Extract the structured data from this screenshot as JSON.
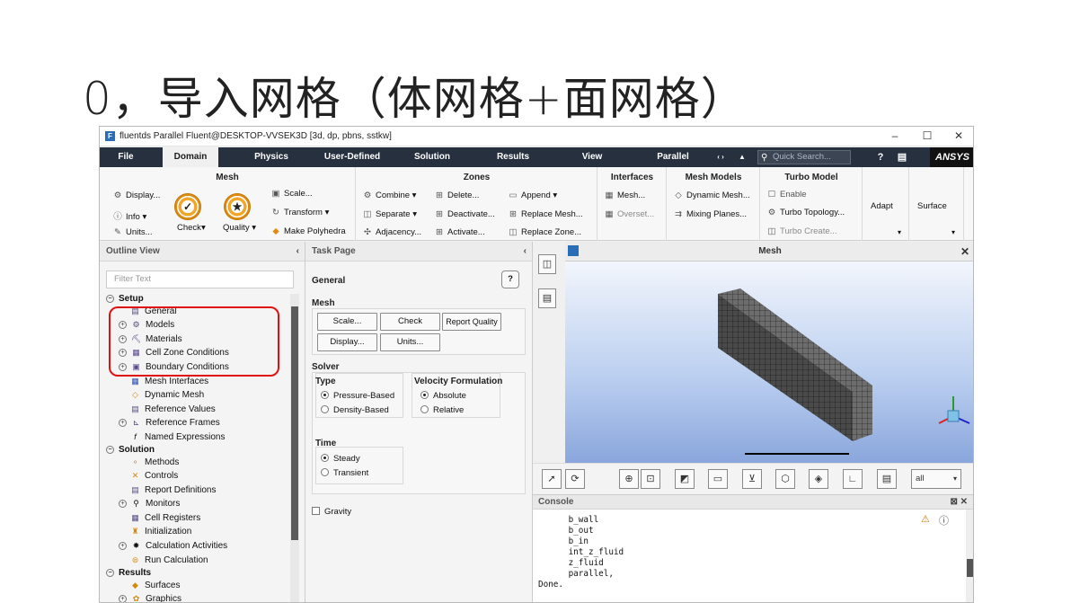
{
  "slide": {
    "title": "0，导入网格（体网格+面网格）"
  },
  "window": {
    "title": "fluentds Parallel Fluent@DESKTOP-VVSEK3D  [3d, dp, pbns, sstkw]",
    "controls": [
      "–",
      "☐",
      "✕"
    ]
  },
  "menubar": {
    "items": [
      "File",
      "Domain",
      "Physics",
      "User-Defined",
      "Solution",
      "Results",
      "View",
      "Parallel"
    ],
    "active": "Domain",
    "search_placeholder": "Quick Search...",
    "brand": "ANSYS"
  },
  "ribbon": {
    "mesh": {
      "header": "Mesh",
      "display": "Display...",
      "info": "Info",
      "units": "Units...",
      "check": "Check",
      "quality": "Quality",
      "scale": "Scale...",
      "transform": "Transform",
      "make_polyhedra": "Make Polyhedra"
    },
    "zones": {
      "header": "Zones",
      "combine": "Combine",
      "separate": "Separate",
      "adjacency": "Adjacency...",
      "delete": "Delete...",
      "deactivate": "Deactivate...",
      "activate": "Activate...",
      "append": "Append",
      "replace_mesh": "Replace Mesh...",
      "replace_zone": "Replace Zone..."
    },
    "interfaces": {
      "header": "Interfaces",
      "mesh": "Mesh...",
      "overset": "Overset..."
    },
    "mesh_models": {
      "header": "Mesh Models",
      "dynamic_mesh": "Dynamic Mesh...",
      "mixing_planes": "Mixing Planes..."
    },
    "turbo": {
      "header": "Turbo Model",
      "enable": "Enable",
      "topology": "Turbo Topology...",
      "create": "Turbo Create..."
    },
    "adapt": "Adapt",
    "surface": "Surface"
  },
  "outline": {
    "header": "Outline View",
    "filter_placeholder": "Filter Text",
    "setup": "Setup",
    "setup_items": [
      "General",
      "Models",
      "Materials",
      "Cell Zone Conditions",
      "Boundary Conditions",
      "Mesh Interfaces",
      "Dynamic Mesh",
      "Reference Values",
      "Reference Frames",
      "Named Expressions"
    ],
    "solution": "Solution",
    "solution_items": [
      "Methods",
      "Controls",
      "Report Definitions",
      "Monitors",
      "Cell Registers",
      "Initialization",
      "Calculation Activities",
      "Run Calculation"
    ],
    "results": "Results",
    "results_items": [
      "Surfaces",
      "Graphics"
    ]
  },
  "task": {
    "header": "Task Page",
    "title": "General",
    "help": "?",
    "mesh_label": "Mesh",
    "btn_scale": "Scale...",
    "btn_check": "Check",
    "btn_report_quality": "Report Quality",
    "btn_display": "Display...",
    "btn_units": "Units...",
    "solver_label": "Solver",
    "type_label": "Type",
    "type_options": [
      "Pressure-Based",
      "Density-Based"
    ],
    "type_selected": "Pressure-Based",
    "velocity_label": "Velocity Formulation",
    "velocity_options": [
      "Absolute",
      "Relative"
    ],
    "velocity_selected": "Absolute",
    "time_label": "Time",
    "time_options": [
      "Steady",
      "Transient"
    ],
    "time_selected": "Steady",
    "gravity": "Gravity"
  },
  "graphics": {
    "title": "Mesh",
    "view_select": "all"
  },
  "console": {
    "header": "Console",
    "lines": [
      "      b_wall",
      "      b_out",
      "      b_in",
      "      int_z_fluid",
      "      z_fluid",
      "      parallel,",
      "Done."
    ]
  }
}
